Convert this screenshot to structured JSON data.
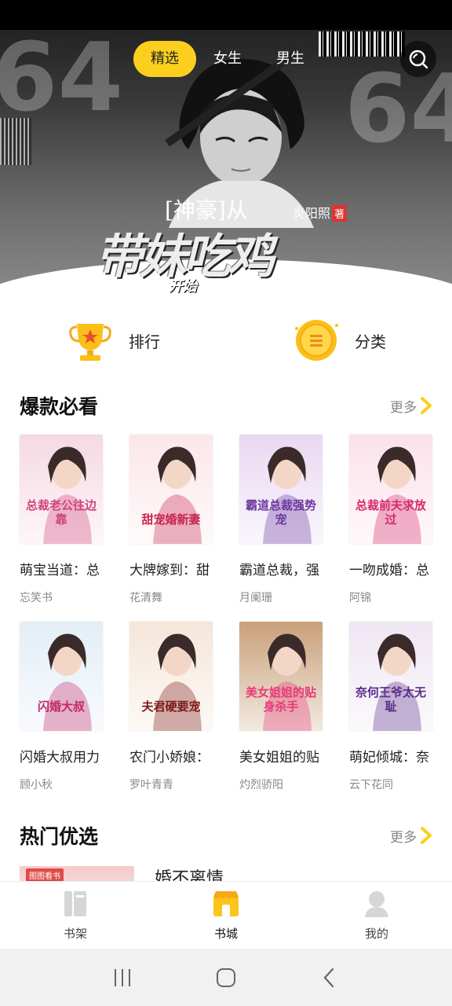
{
  "header": {
    "tabs": [
      {
        "label": "精选",
        "active": true
      },
      {
        "label": "女生",
        "active": false
      },
      {
        "label": "男生",
        "active": false
      }
    ],
    "search_icon": "search-icon"
  },
  "banner": {
    "title_prefix": "[神豪]从",
    "title_main": "带妹吃鸡",
    "title_suffix": "开始",
    "author": "炎阳照",
    "author_mark": "著",
    "deco_number": "64"
  },
  "quick_links": [
    {
      "label": "排行",
      "icon": "trophy-icon"
    },
    {
      "label": "分类",
      "icon": "category-medal-icon"
    }
  ],
  "section_hits": {
    "title": "爆款必看",
    "more_label": "更多",
    "books": [
      {
        "title": "萌宝当道：总",
        "author": "忘笑书",
        "cover_text": "总裁老公往边靠",
        "bg": "#f6d9e2",
        "fg": "#d0467a"
      },
      {
        "title": "大牌嫁到：甜",
        "author": "花清舞",
        "cover_text": "甜宠婚新妻",
        "bg": "#fbe7ea",
        "fg": "#c7264f"
      },
      {
        "title": "霸道总裁，强",
        "author": "月阑珊",
        "cover_text": "霸道总裁强势宠",
        "bg": "#e9d8f2",
        "fg": "#6b3aa0"
      },
      {
        "title": "一吻成婚：总",
        "author": "阿锦",
        "cover_text": "总裁前夫求放过",
        "bg": "#fbe1ea",
        "fg": "#d62a6a"
      },
      {
        "title": "闪婚大叔用力",
        "author": "顾小秋",
        "cover_text": "闪婚大叔",
        "bg": "#e3eef6",
        "fg": "#c2286a"
      },
      {
        "title": "农门小娇娘：",
        "author": "罗叶青青",
        "cover_text": "夫君硬要宠",
        "bg": "#f5e6d9",
        "fg": "#7a1b1b"
      },
      {
        "title": "美女姐姐的贴",
        "author": "灼烈骄阳",
        "cover_text": "美女姐姐的贴身杀手",
        "bg": "#c9a07a",
        "fg": "#e83b7a"
      },
      {
        "title": "萌妃倾城：奈",
        "author": "云下花同",
        "cover_text": "奈何王爷太无耻",
        "bg": "#efe6f3",
        "fg": "#5b2d8a"
      }
    ]
  },
  "section_hot": {
    "title": "热门优选",
    "more_label": "更多",
    "first_title": "婚不离情",
    "first_tag": "图图看书"
  },
  "bottom_nav": [
    {
      "label": "书架",
      "icon": "bookshelf-icon",
      "active": false
    },
    {
      "label": "书城",
      "icon": "bookstore-icon",
      "active": true
    },
    {
      "label": "我的",
      "icon": "profile-icon",
      "active": false
    }
  ],
  "colors": {
    "accent": "#fbcf1e",
    "text": "#222222",
    "muted": "#888888"
  }
}
